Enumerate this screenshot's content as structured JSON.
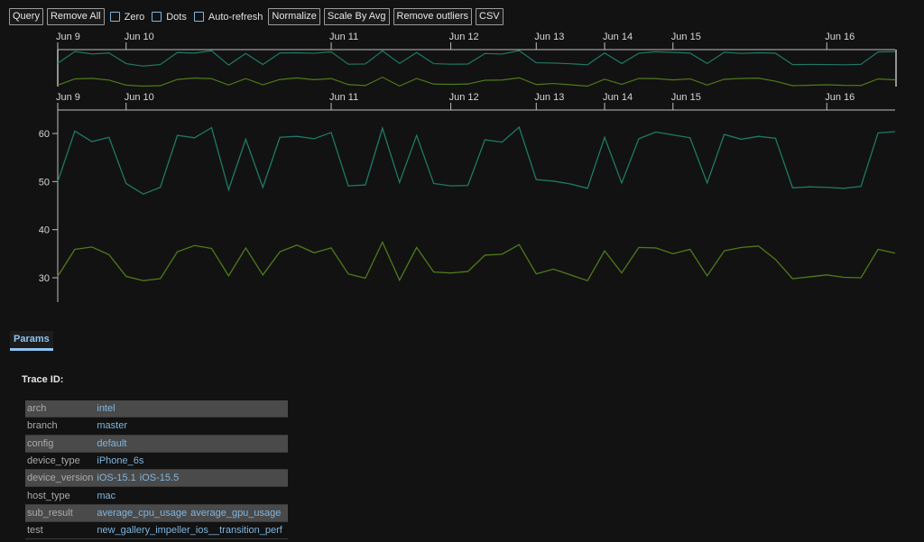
{
  "toolbar": {
    "query_label": "Query",
    "remove_all_label": "Remove All",
    "zero_label": "Zero",
    "dots_label": "Dots",
    "auto_refresh_label": "Auto-refresh",
    "normalize_label": "Normalize",
    "scale_by_avg_label": "Scale By Avg",
    "remove_outliers_label": "Remove outliers",
    "csv_label": "CSV",
    "zero_checked": false,
    "dots_checked": false,
    "auto_refresh_checked": false
  },
  "colors": {
    "series_cpu": "#1f7a66",
    "series_gpu": "#4f7a1a",
    "accent": "#8dc4f0",
    "background": "#121212"
  },
  "chart_data": {
    "type": "line",
    "title": "",
    "xlabel": "",
    "ylabel": "",
    "ylim": [
      25,
      65
    ],
    "yticks": [
      30,
      40,
      50,
      60
    ],
    "x_tick_labels": [
      "Jun 9",
      "Jun 10",
      "Jun 11",
      "Jun 12",
      "Jun 13",
      "Jun 14",
      "Jun 15",
      "Jun 16"
    ],
    "x_tick_indices": [
      0,
      4,
      16,
      23,
      28,
      32,
      36,
      45
    ],
    "grid": false,
    "legend": "none",
    "overview_brush": "full range selected",
    "series": [
      {
        "name": "average_cpu_usage",
        "values": [
          50.0,
          60.5,
          58.3,
          59.2,
          49.6,
          47.4,
          48.8,
          59.6,
          59.1,
          61.2,
          48.3,
          58.8,
          48.8,
          59.2,
          59.4,
          58.9,
          60.2,
          49.1,
          49.3,
          61.1,
          49.8,
          59.6,
          49.6,
          49.1,
          49.2,
          58.7,
          58.2,
          61.3,
          50.4,
          50.1,
          49.5,
          48.6,
          59.2,
          49.7,
          58.9,
          60.3,
          59.7,
          59.1,
          49.7,
          59.8,
          58.8,
          59.4,
          59.0,
          48.7,
          48.9,
          48.8,
          48.6,
          49.0,
          60.1,
          60.4
        ]
      },
      {
        "name": "average_gpu_usage",
        "values": [
          30.3,
          35.9,
          36.4,
          34.8,
          30.3,
          29.4,
          29.8,
          35.4,
          36.7,
          36.1,
          30.4,
          36.2,
          30.6,
          35.4,
          36.8,
          35.2,
          36.2,
          30.8,
          29.9,
          37.4,
          29.5,
          36.3,
          31.2,
          31.0,
          31.3,
          34.7,
          34.9,
          36.9,
          30.8,
          31.8,
          30.6,
          29.4,
          35.6,
          31.0,
          36.3,
          36.2,
          35.0,
          35.9,
          30.4,
          35.6,
          36.3,
          36.6,
          33.8,
          29.8,
          30.2,
          30.6,
          30.1,
          30.0,
          35.9,
          35.1
        ]
      }
    ]
  },
  "params": {
    "tab_label": "Params",
    "trace_id_label": "Trace ID:",
    "rows": [
      {
        "key": "arch",
        "values": [
          "intel"
        ]
      },
      {
        "key": "branch",
        "values": [
          "master"
        ]
      },
      {
        "key": "config",
        "values": [
          "default"
        ]
      },
      {
        "key": "device_type",
        "values": [
          "iPhone_6s"
        ]
      },
      {
        "key": "device_version",
        "values": [
          "iOS-15.1",
          "iOS-15.5"
        ]
      },
      {
        "key": "host_type",
        "values": [
          "mac"
        ]
      },
      {
        "key": "sub_result",
        "values": [
          "average_cpu_usage",
          "average_gpu_usage"
        ]
      },
      {
        "key": "test",
        "values": [
          "new_gallery_impeller_ios__transition_perf"
        ]
      }
    ]
  }
}
